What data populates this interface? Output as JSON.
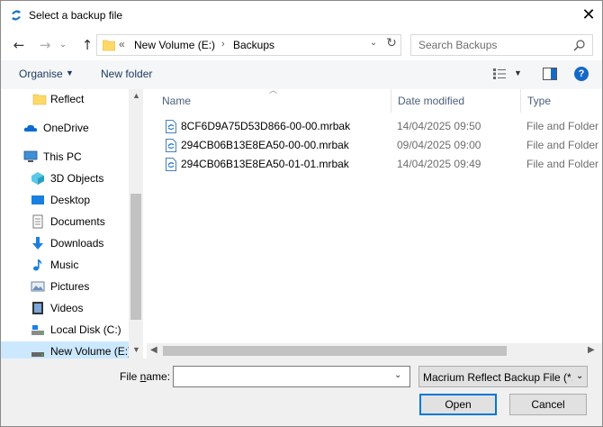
{
  "window": {
    "title": "Select a backup file",
    "close_glyph": "✕"
  },
  "nav": {
    "back_glyph": "←",
    "forward_glyph": "→",
    "up_glyph": "↑",
    "recent_glyph": "⌄"
  },
  "address": {
    "overflow": "«",
    "parts": [
      "New Volume (E:)",
      "Backups"
    ],
    "separator": "›",
    "dropdown_glyph": "⌄",
    "refresh_glyph": "↻"
  },
  "search": {
    "placeholder": "Search Backups"
  },
  "toolbar": {
    "organise": "Organise",
    "new_folder": "New folder",
    "help": "?"
  },
  "sidebar": {
    "items": [
      {
        "label": "Reflect",
        "icon": "folder-icon"
      },
      {
        "label": "OneDrive",
        "icon": "onedrive-cloud-icon"
      },
      {
        "label": "This PC",
        "icon": "this-pc-icon"
      },
      {
        "label": "3D Objects",
        "icon": "3d-objects-icon"
      },
      {
        "label": "Desktop",
        "icon": "desktop-icon"
      },
      {
        "label": "Documents",
        "icon": "documents-icon"
      },
      {
        "label": "Downloads",
        "icon": "downloads-icon"
      },
      {
        "label": "Music",
        "icon": "music-icon"
      },
      {
        "label": "Pictures",
        "icon": "pictures-icon"
      },
      {
        "label": "Videos",
        "icon": "videos-icon"
      },
      {
        "label": "Local Disk (C:)",
        "icon": "local-disk-icon"
      },
      {
        "label": "New Volume (E:)",
        "icon": "drive-icon",
        "selected": true
      }
    ]
  },
  "files": {
    "columns": [
      "Name",
      "Date modified",
      "Type"
    ],
    "rows": [
      {
        "name": "8CF6D9A75D53D866-00-00.mrbak",
        "date": "14/04/2025 09:50",
        "type": "File and Folder B"
      },
      {
        "name": "294CB06B13E8EA50-00-00.mrbak",
        "date": "09/04/2025 09:00",
        "type": "File and Folder B"
      },
      {
        "name": "294CB06B13E8EA50-01-01.mrbak",
        "date": "14/04/2025 09:49",
        "type": "File and Folder B"
      }
    ]
  },
  "footer": {
    "file_name_label_pre": "File ",
    "file_name_label_u": "n",
    "file_name_label_post": "ame:",
    "file_name_value": "",
    "filter": "Macrium Reflect Backup File (*.",
    "open": "Open",
    "cancel": "Cancel"
  },
  "colors": {
    "accent": "#0078d7",
    "selection": "#cce8ff",
    "toolbar_text": "#1e3b60",
    "folder": "#ffd868"
  }
}
